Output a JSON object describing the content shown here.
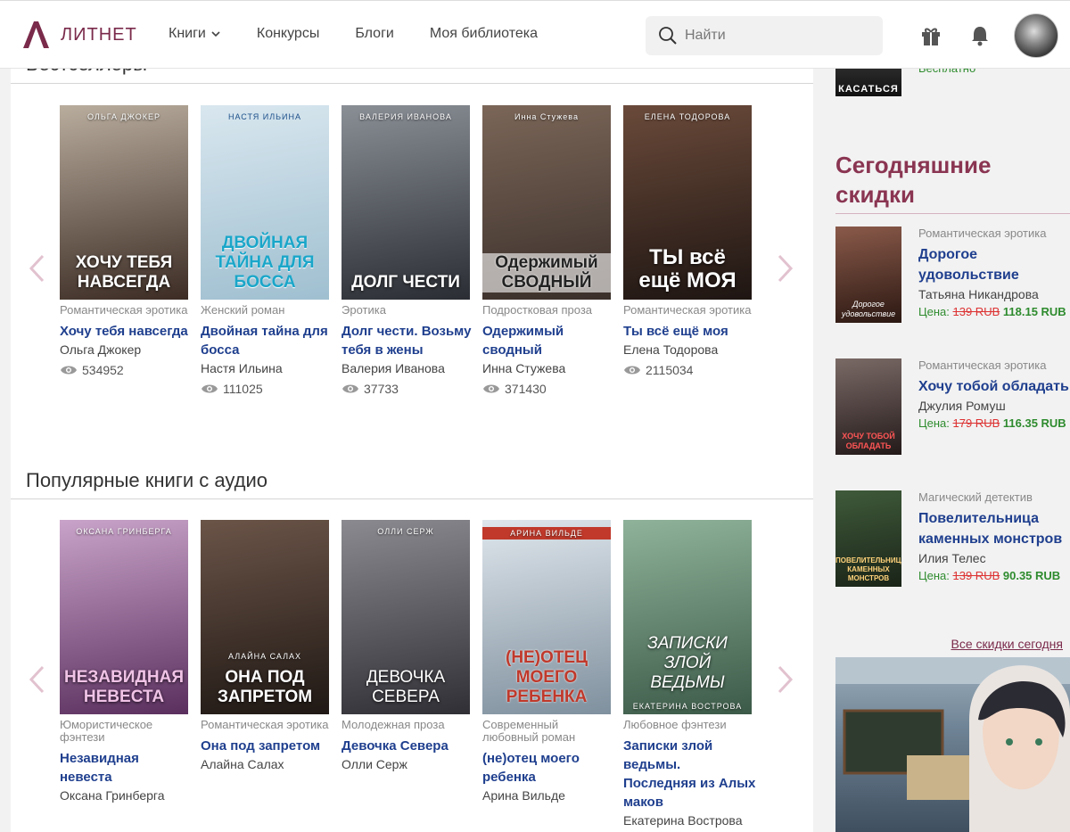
{
  "header": {
    "logo_text": "ЛИТНЕТ",
    "nav": [
      "Книги",
      "Конкурсы",
      "Блоги",
      "Моя библиотека"
    ],
    "search_placeholder": "Найти"
  },
  "bestsellers": {
    "title": "Бестселлеры",
    "books": [
      {
        "genre": "Романтическая эротика",
        "title": "Хочу тебя навсегда",
        "author": "Ольга Джокер",
        "views": "534952",
        "cover_author": "ОЛЬГА ДЖОКЕР",
        "cover_title": "ХОЧУ ТЕБЯ НАВСЕГДА",
        "c1": "#b9ad9e",
        "c2": "#3c2c24"
      },
      {
        "genre": "Женский роман",
        "title": "Двойная тайна для босса",
        "author": "Настя Ильина",
        "views": "111025",
        "cover_author": "НАСТЯ ИЛЬИНА",
        "cover_title": "ДВОЙНАЯ ТАЙНА ДЛЯ БОССА",
        "c1": "#d9e7ef",
        "c2": "#9fbfd0"
      },
      {
        "genre": "Эротика",
        "title": "Долг чести. Возьму тебя в жены",
        "author": "Валерия Иванова",
        "views": "37733",
        "cover_author": "ВАЛЕРИЯ ИВАНОВА",
        "cover_title": "ДОЛГ ЧЕСТИ",
        "c1": "#8a8f96",
        "c2": "#2a2d33"
      },
      {
        "genre": "Подростковая проза",
        "title": "Одержимый сводный",
        "author": "Инна Стужева",
        "views": "371430",
        "cover_author": "Инна Стужева",
        "cover_title": "Одержимый СВОДНЫЙ",
        "c1": "#7b6658",
        "c2": "#3a2f2a"
      },
      {
        "genre": "Романтическая эротика",
        "title": "Ты всё ещё моя",
        "author": "Елена Тодорова",
        "views": "2115034",
        "cover_author": "ЕЛЕНА ТОДОРОВА",
        "cover_title": "ТЫ всё ещё МОЯ",
        "c1": "#6a4a3a",
        "c2": "#1e1512"
      }
    ]
  },
  "audio": {
    "title": "Популярные книги с аудио",
    "books": [
      {
        "genre": "Юмористическое фэнтези",
        "title": "Незавидная невеста",
        "author": "Оксана Гринберга",
        "cover_author": "ОКСАНА ГРИНБЕРГА",
        "cover_title": "НЕЗАВИДНАЯ НЕВЕСТА",
        "c1": "#c9a3c9",
        "c2": "#5a2f5e"
      },
      {
        "genre": "Романтическая эротика",
        "title": "Она под запретом",
        "author": "Алайна Салах",
        "cover_author": "АЛАЙНА САЛАХ",
        "cover_title": "ОНА ПОД ЗАПРЕТОМ",
        "c1": "#6b5448",
        "c2": "#1f1814"
      },
      {
        "genre": "Молодежная проза",
        "title": "Девочка Севера",
        "author": "Олли Серж",
        "cover_author": "ОЛЛИ СЕРЖ",
        "cover_title": "ДЕВОЧКА СЕВЕРА",
        "c1": "#8a8a90",
        "c2": "#2f2f35"
      },
      {
        "genre": "Современный любовный роман",
        "title": "(не)отец моего ребенка",
        "author": "Арина Вильде",
        "cover_author": "АРИНА ВИЛЬДЕ",
        "cover_title": "(НЕ)ОТЕЦ МОЕГО РЕБЕНКА",
        "c1": "#dfe6ec",
        "c2": "#7f909e"
      },
      {
        "genre": "Любовное фэнтези",
        "title": "Записки злой ведьмы. Последняя из Алых маков",
        "author": "Екатерина Вострова",
        "cover_author": "ЕКАТЕРИНА ВОСТРОВА",
        "cover_title": "ЗАПИСКИ ЗЛОЙ ВЕДЬМЫ",
        "c1": "#8fb39a",
        "c2": "#3c5a48"
      }
    ]
  },
  "sidebar": {
    "top_cover_text": "КАСАТЬСЯ",
    "top_price": "Бесплатно",
    "title": "Сегодняшние скидки",
    "price_label": "Цена:",
    "deals": [
      {
        "genre": "Романтическая эротика",
        "title": "Дорогое удовольствие",
        "author": "Татьяна Никандрова",
        "old_price": "139 RUB",
        "new_price": "118.15 RUB",
        "cover_text": "Дорогое удовольствие",
        "c1": "#8a5a4a",
        "c2": "#2b1812"
      },
      {
        "genre": "Романтическая эротика",
        "title": "Хочу тобой обладать",
        "author": "Джулия Ромуш",
        "old_price": "179 RUB",
        "new_price": "116.35 RUB",
        "cover_text": "ХОЧУ ТОБОЙ ОБЛАДАТЬ",
        "c1": "#7a6a66",
        "c2": "#241a1a"
      },
      {
        "genre": "Магический детектив",
        "title": "Повелительница каменных монстров",
        "author": "Илия Телес",
        "old_price": "139 RUB",
        "new_price": "90.35 RUB",
        "cover_text": "ПОВЕЛИТЕЛЬНИЦА КАМЕННЫХ МОНСТРОВ",
        "c1": "#3f5a3a",
        "c2": "#1a2418"
      }
    ],
    "all_deals": "Все скидки сегодня"
  }
}
